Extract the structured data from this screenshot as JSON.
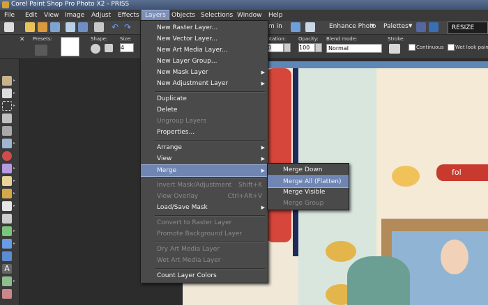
{
  "window": {
    "title": "Corel Paint Shop Pro Photo X2 - PRISS"
  },
  "menubar": {
    "items": [
      "File",
      "Edit",
      "View",
      "Image",
      "Adjust",
      "Effects",
      "Layers",
      "Objects",
      "Selections",
      "Window",
      "Help"
    ],
    "active": "Layers"
  },
  "toolbar": {
    "zoom_in_label": "m in",
    "enhance_photo": "Enhance Photo",
    "palettes": "Palettes",
    "resize_button": "RESIZE FOR W"
  },
  "tool_options": {
    "presets_label": "Presets:",
    "shape_label": "Shape:",
    "size_label": "Size:",
    "size_value": "4",
    "rotation_label": "otation:",
    "rotation_value": "0",
    "opacity_label": "Opacity:",
    "opacity_value": "100",
    "blend_mode_label": "Blend mode:",
    "blend_mode_value": "Normal",
    "stroke_label": "Stroke:",
    "continuous_label": "Continuous",
    "wet_look_label": "Wet look paint"
  },
  "layers_menu": {
    "groups": [
      [
        {
          "label": "New Raster Layer...",
          "enabled": true,
          "submenu": false
        },
        {
          "label": "New Vector Layer...",
          "enabled": true,
          "submenu": false
        },
        {
          "label": "New Art Media Layer...",
          "enabled": true,
          "submenu": false
        },
        {
          "label": "New Layer Group...",
          "enabled": true,
          "submenu": false
        },
        {
          "label": "New Mask Layer",
          "enabled": true,
          "submenu": true
        },
        {
          "label": "New Adjustment Layer",
          "enabled": true,
          "submenu": true
        }
      ],
      [
        {
          "label": "Duplicate",
          "enabled": true,
          "submenu": false
        },
        {
          "label": "Delete",
          "enabled": true,
          "submenu": false
        },
        {
          "label": "Ungroup Layers",
          "enabled": false,
          "submenu": false
        },
        {
          "label": "Properties...",
          "enabled": true,
          "submenu": false
        }
      ],
      [
        {
          "label": "Arrange",
          "enabled": true,
          "submenu": true
        },
        {
          "label": "View",
          "enabled": true,
          "submenu": true
        },
        {
          "label": "Merge",
          "enabled": true,
          "submenu": true,
          "highlighted": true
        }
      ],
      [
        {
          "label": "Invert Mask/Adjustment",
          "enabled": false,
          "submenu": false,
          "shortcut": "Shift+K"
        },
        {
          "label": "View Overlay",
          "enabled": false,
          "submenu": false,
          "shortcut": "Ctrl+Alt+V"
        },
        {
          "label": "Load/Save Mask",
          "enabled": true,
          "submenu": true
        }
      ],
      [
        {
          "label": "Convert to Raster Layer",
          "enabled": false,
          "submenu": false
        },
        {
          "label": "Promote Background Layer",
          "enabled": false,
          "submenu": false
        }
      ],
      [
        {
          "label": "Dry Art Media Layer",
          "enabled": false,
          "submenu": false
        },
        {
          "label": "Wet Art Media Layer",
          "enabled": false,
          "submenu": false
        }
      ],
      [
        {
          "label": "Count Layer Colors",
          "enabled": true,
          "submenu": false
        }
      ]
    ]
  },
  "merge_submenu": {
    "items": [
      {
        "label": "Merge Down",
        "enabled": true
      },
      {
        "label": "Merge All (Flatten)",
        "enabled": true,
        "highlighted": true
      },
      {
        "label": "Merge Visible",
        "enabled": true
      },
      {
        "label": "Merge Group",
        "enabled": false
      }
    ]
  },
  "canvas": {
    "tag_text": "fol"
  },
  "colors": {
    "menu_bg": "#4a4a4a",
    "highlight": "#6f86b5",
    "disabled_text": "#8c8c8c"
  }
}
